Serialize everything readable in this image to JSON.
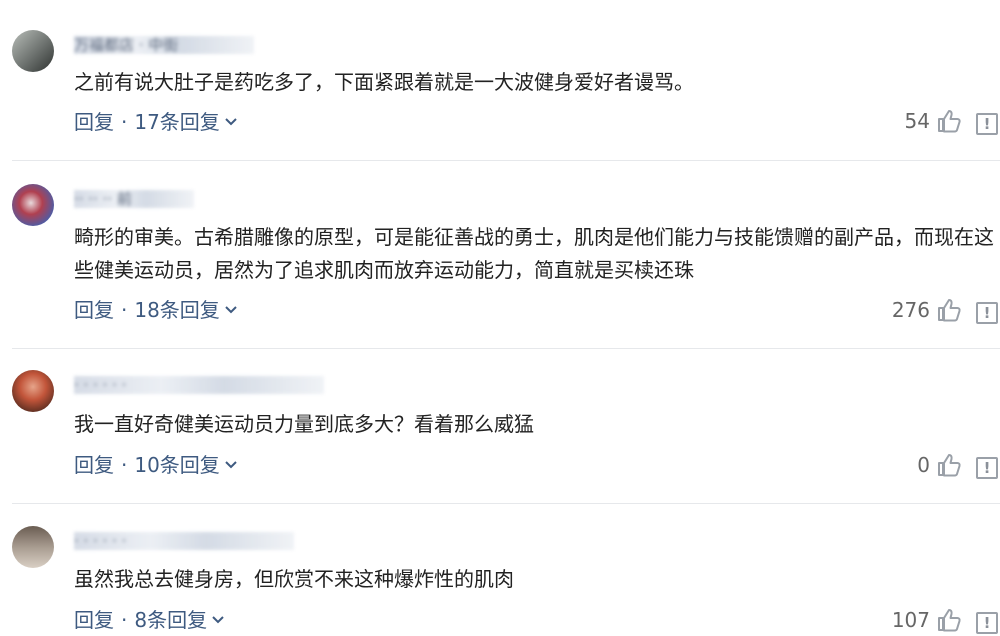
{
  "comments": [
    {
      "username": "万福都店 · 中街",
      "text": "之前有说大肚子是药吃多了，下面紧跟着就是一大波健身爱好者谩骂。",
      "reply_label": "回复",
      "more_replies_label": "17条回复",
      "likes": "54",
      "avatar_colors": [
        "#8a8f8a",
        "#3f4442"
      ]
    },
    {
      "username": "·· ·· ·· 前",
      "text": "畸形的审美。古希腊雕像的原型，可是能征善战的勇士，肌肉是他们能力与技能馈赠的副产品，而现在这些健美运动员，居然为了追求肌肉而放弃运动能力，简直就是买椟还珠",
      "reply_label": "回复",
      "more_replies_label": "18条回复",
      "likes": "276",
      "avatar_colors": [
        "#b04050",
        "#4a5da8"
      ]
    },
    {
      "username": "· · · · · ·",
      "text": "我一直好奇健美运动员力量到底多大？看着那么威猛",
      "reply_label": "回复",
      "more_replies_label": "10条回复",
      "likes": "0",
      "avatar_colors": [
        "#c2553a",
        "#5a2d20"
      ]
    },
    {
      "username": "· · · · · ·",
      "text": "虽然我总去健身房，但欣赏不来这种爆炸性的肌肉",
      "reply_label": "回复",
      "more_replies_label": "8条回复",
      "likes": "107",
      "avatar_colors": [
        "#6a5d52",
        "#d9cfc4"
      ]
    }
  ],
  "colors": {
    "link": "#3e5a80",
    "text": "#222222",
    "muted": "#666666",
    "divider": "#e6e8eb"
  },
  "icons": {
    "like": "thumbs-up-icon",
    "report": "report-icon",
    "expand": "chevron-down-icon"
  }
}
